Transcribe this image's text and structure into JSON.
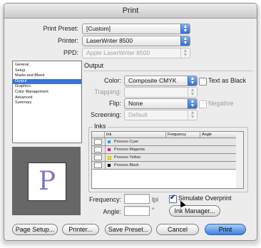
{
  "window": {
    "title": "Print"
  },
  "preset": {
    "label": "Print Preset:",
    "value": "[Custom]"
  },
  "printer": {
    "label": "Printer:",
    "value": "LaserWriter 8500"
  },
  "ppd": {
    "label": "PPD:",
    "value": "Apple LaserWriter 8500"
  },
  "sidebar": {
    "items": [
      {
        "label": "General"
      },
      {
        "label": "Setup"
      },
      {
        "label": "Marks and Bleed"
      },
      {
        "label": "Output",
        "selected": true
      },
      {
        "label": "Graphics"
      },
      {
        "label": "Color Management"
      },
      {
        "label": "Advanced"
      },
      {
        "label": "Summary"
      }
    ]
  },
  "preview": {
    "letter": "P"
  },
  "output": {
    "section_title": "Output",
    "color_label": "Color:",
    "color_value": "Composite CMYK",
    "text_as_black_label": "Text as Black",
    "trapping_label": "Trapping:",
    "trapping_value": "",
    "flip_label": "Flip:",
    "flip_value": "None",
    "negative_label": "Negative",
    "screening_label": "Screening:",
    "screening_value": "Default"
  },
  "inks": {
    "group_title": "Inks",
    "headers": {
      "ink": "Ink",
      "frequency": "Frequency",
      "angle": "Angle"
    },
    "rows": [
      {
        "name": "Process Cyan",
        "swatch": "#00aeef"
      },
      {
        "name": "Process Magenta",
        "swatch": "#ec008c"
      },
      {
        "name": "Process Yellow",
        "swatch": "#fff200"
      },
      {
        "name": "Process Black",
        "swatch": "#000000"
      }
    ]
  },
  "frequency": {
    "label": "Frequency:",
    "value": "",
    "unit": "lpi"
  },
  "angle": {
    "label": "Angle:",
    "value": "",
    "unit": "°"
  },
  "simulate_overprint": {
    "label": "Simulate Overprint",
    "checked": true
  },
  "ink_manager": {
    "label": "Ink Manager..."
  },
  "buttons": {
    "page_setup": "Page Setup...",
    "printer": "Printer...",
    "save_preset": "Save Preset...",
    "cancel": "Cancel",
    "print": "Print"
  },
  "colors": {
    "accent": "#3875d7",
    "preview_bg": "#676767",
    "letter": "#7a79c4"
  }
}
